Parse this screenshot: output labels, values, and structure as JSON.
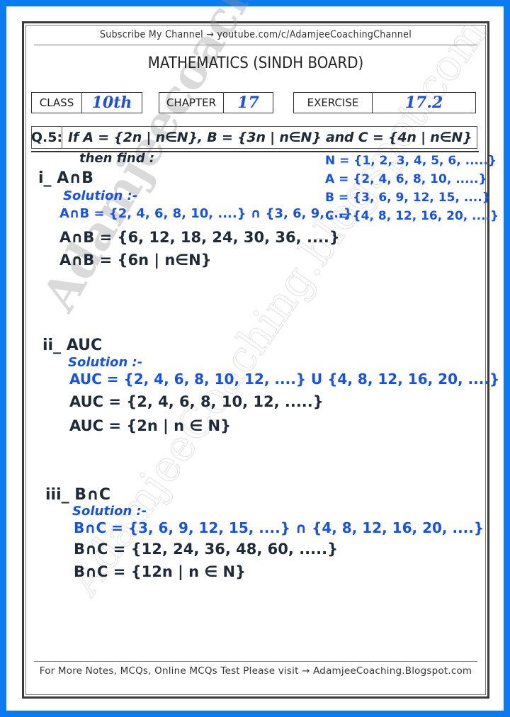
{
  "header": {
    "channel_link": "Subscribe My Channel → youtube.com/c/AdamjeeCoachingChannel",
    "title": "MATHEMATICS (SINDH BOARD)",
    "class_label": "CLASS",
    "class_value": "10th",
    "chapter_label": "CHAPTER",
    "chapter_value": "17",
    "exercise_label": "EXERCISE",
    "exercise_value": "17.2"
  },
  "question": {
    "number": "Q.5:",
    "text": "If A = {2n | n∈N}, B = {3n | n∈N} and C = {4n | n∈N}",
    "then_find": "then find :"
  },
  "given_sets": [
    "N = {1, 2, 3, 4, 5, 6, .....}",
    "A = {2, 4, 6, 8, 10, .....}",
    "B = {3, 6, 9, 12, 15, ....}",
    "C = {4, 8, 12, 16, 20, ....}"
  ],
  "parts": [
    {
      "label": "i_ A∩B",
      "solution_label": "Solution :-",
      "lines": [
        "A∩B = {2, 4, 6, 8, 10, ....} ∩ {3, 6, 9, ...}",
        "A∩B = {6, 12, 18, 24, 30, 36, ....}",
        "A∩B = {6n | n∈N}"
      ]
    },
    {
      "label": "ii_ AUC",
      "solution_label": "Solution :-",
      "lines": [
        "AUC = {2, 4, 6, 8, 10, 12, ....} U {4, 8, 12, 16, 20, ....}",
        "AUC = {2, 4, 6, 8, 10, 12, .....}",
        "AUC = {2n | n ∈ N}"
      ]
    },
    {
      "label": "iii_ B∩C",
      "solution_label": "Solution :-",
      "lines": [
        "B∩C = {3, 6, 9, 12, 15, ....} ∩ {4, 8, 12, 16, 20, ....}",
        "B∩C = {12, 24, 36, 48, 60, .....}",
        "B∩C = {12n | n ∈ N}"
      ]
    }
  ],
  "footer": {
    "text": "For More Notes, MCQs, Online MCQs Test Please visit → AdamjeeCoaching.Blogspot.com"
  },
  "watermark": {
    "primary": "Adamjeecoaching.blogspot.com",
    "secondary": "AdamjeeCoaching.blogspot.com"
  },
  "colors": {
    "page_border": "#0a7cf2",
    "ink_blue": "#1652e8",
    "ink_dark": "#1f2a38"
  }
}
